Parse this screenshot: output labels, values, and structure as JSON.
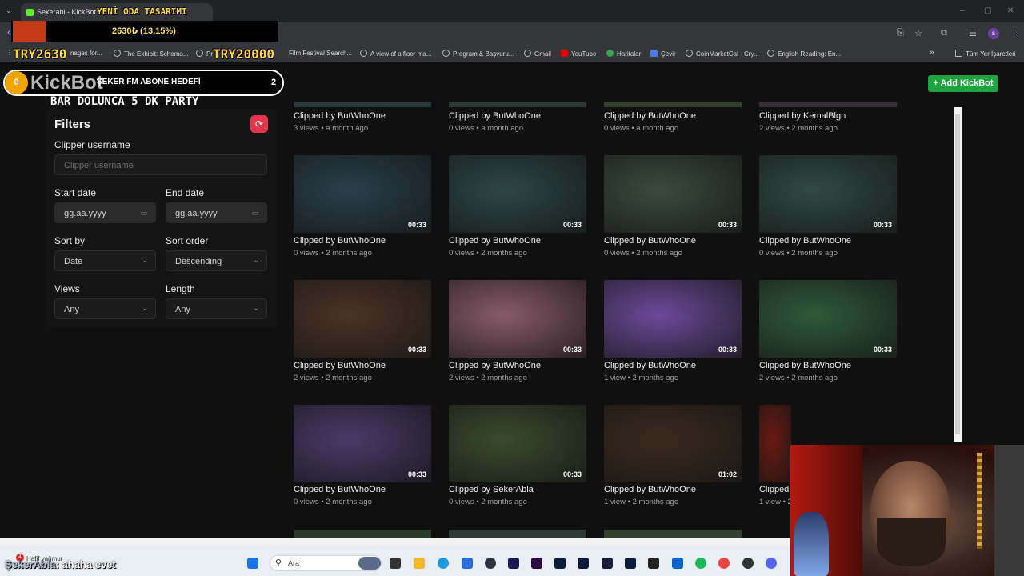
{
  "browser": {
    "tab_title": "Sekerabi - KickBot",
    "bookmarks": [
      {
        "label": "nages for..."
      },
      {
        "label": "The Exhibit: Schema..."
      },
      {
        "label": "Pr"
      },
      {
        "label": "Film Festival Search..."
      },
      {
        "label": "A view of a floor ma..."
      },
      {
        "label": "Program & Başvuru..."
      },
      {
        "label": "Gmail"
      },
      {
        "label": "YouTube"
      },
      {
        "label": "Haritalar"
      },
      {
        "label": "Çevir"
      },
      {
        "label": "CoinMarketCal - Cry..."
      },
      {
        "label": "English Reading: En..."
      }
    ],
    "bookmarks_more": "»",
    "all_bookmarks": "Tüm Yer İşaretleri",
    "profile_initial": "s"
  },
  "overlay": {
    "room_title": "YENİ ODA TASARIMI",
    "donation_progress": "2630₺ (13.15%)",
    "try_current": "TRY2630",
    "try_goal": "TRY20000",
    "goal_circle": "0",
    "goal_label": "ŞEKER FM ABONE HEDEFİ",
    "goal_count": "2",
    "kickbot_logo": "KickBot",
    "party_text": "BAR DOLUNCA 5 DK PARTY"
  },
  "header": {
    "add_button": "+ Add KickBot"
  },
  "filters": {
    "title": "Filters",
    "reset_icon": "refresh-icon",
    "clipper_label": "Clipper username",
    "clipper_placeholder": "Clipper username",
    "start_label": "Start date",
    "start_value": "gg.aa.yyyy",
    "end_label": "End date",
    "end_value": "gg.aa.yyyy",
    "sort_by_label": "Sort by",
    "sort_by_value": "Date",
    "sort_order_label": "Sort order",
    "sort_order_value": "Descending",
    "views_label": "Views",
    "views_value": "Any",
    "length_label": "Length",
    "length_value": "Any"
  },
  "clips": [
    {
      "title": "Clipped by ButWhoOne",
      "meta": "3 views • a month ago"
    },
    {
      "title": "Clipped by ButWhoOne",
      "meta": "0 views • a month ago"
    },
    {
      "title": "Clipped by ButWhoOne",
      "meta": "0 views • a month ago"
    },
    {
      "title": "Clipped by KemalBlgn",
      "meta": "2 views • 2 months ago"
    },
    {
      "title": "Clipped by ButWhoOne",
      "meta": "0 views • 2 months ago",
      "duration": "00:33",
      "color": "#28404a"
    },
    {
      "title": "Clipped by ButWhoOne",
      "meta": "0 views • 2 months ago",
      "duration": "00:33",
      "color": "#2d4646"
    },
    {
      "title": "Clipped by ButWhoOne",
      "meta": "0 views • 2 months ago",
      "duration": "00:33",
      "color": "#3a4a3e"
    },
    {
      "title": "Clipped by ButWhoOne",
      "meta": "0 views • 2 months ago",
      "duration": "00:33",
      "color": "#2f4a44"
    },
    {
      "title": "Clipped by ButWhoOne",
      "meta": "2 views • 2 months ago",
      "duration": "00:33",
      "color": "#4a3326"
    },
    {
      "title": "Clipped by ButWhoOne",
      "meta": "2 views • 2 months ago",
      "duration": "00:33",
      "color": "#8a5a6a"
    },
    {
      "title": "Clipped by ButWhoOne",
      "meta": "1 view • 2 months ago",
      "duration": "00:33",
      "color": "#6b4a9a"
    },
    {
      "title": "Clipped by ButWhoOne",
      "meta": "2 views • 2 months ago",
      "duration": "00:33",
      "color": "#2f5a3a"
    },
    {
      "title": "Clipped by ButWhoOne",
      "meta": "0 views • 2 months ago",
      "duration": "00:33",
      "color": "#4a3a6a"
    },
    {
      "title": "Clipped by SekerAbla",
      "meta": "0 views • 2 months ago",
      "duration": "00:33",
      "color": "#3a4a2e"
    },
    {
      "title": "Clipped by ButWhoOne",
      "meta": "1 view • 2 months ago",
      "duration": "01:02",
      "color": "#3a2a1e"
    },
    {
      "title": "Clipped",
      "meta": "1 view • 2",
      "duration": "",
      "color": "#6a1a12"
    }
  ],
  "taskbar": {
    "weather_badge": "4",
    "weather_text": "Hafif yağmur",
    "search_placeholder": "Ara",
    "app_icons": [
      "windows-start",
      "task-view",
      "file-explorer",
      "edge",
      "store",
      "obs",
      "after-effects",
      "premiere",
      "photoshop",
      "animate",
      "character-animator",
      "lightroom",
      "capcut",
      "outlook",
      "spotify",
      "chrome",
      "app",
      "discord"
    ]
  },
  "chat": {
    "user": "ŞekerAbla",
    "message": ": ahaha evet"
  }
}
